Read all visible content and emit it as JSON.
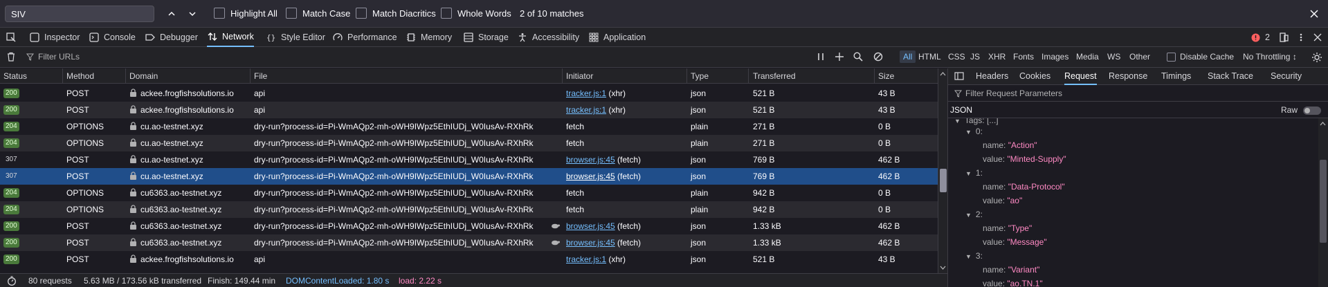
{
  "findbar": {
    "query": "SIV",
    "options": [
      "Highlight All",
      "Match Case",
      "Match Diacritics",
      "Whole Words"
    ],
    "match_count": "2 of 10 matches"
  },
  "tabs": [
    "Inspector",
    "Console",
    "Debugger",
    "Network",
    "Style Editor",
    "Performance",
    "Memory",
    "Storage",
    "Accessibility",
    "Application"
  ],
  "error_count": "2",
  "filter": {
    "placeholder": "Filter URLs",
    "types": [
      "All",
      "HTML",
      "CSS",
      "JS",
      "XHR",
      "Fonts",
      "Images",
      "Media",
      "WS",
      "Other"
    ],
    "disable_cache": "Disable Cache",
    "throttling": "No Throttling ↕"
  },
  "columns": [
    "Status",
    "Method",
    "Domain",
    "File",
    "Initiator",
    "Type",
    "Transferred",
    "Size"
  ],
  "requests": [
    {
      "status": "200",
      "method": "POST",
      "domain": "ackee.frogfishsolutions.io",
      "file": "api",
      "initiator": "tracker.js:1",
      "initiator_suffix": " (xhr)",
      "type": "json",
      "transferred": "521 B",
      "size": "43 B"
    },
    {
      "status": "200",
      "method": "POST",
      "domain": "ackee.frogfishsolutions.io",
      "file": "api",
      "initiator": "tracker.js:1",
      "initiator_suffix": " (xhr)",
      "type": "json",
      "transferred": "521 B",
      "size": "43 B"
    },
    {
      "status": "204",
      "method": "OPTIONS",
      "domain": "cu.ao-testnet.xyz",
      "file": "dry-run?process-id=Pi-WmAQp2-mh-oWH9IWpz5EthIUDj_W0IusAv-RXhRk",
      "initiator": "",
      "initiator_suffix": "fetch",
      "type": "plain",
      "transferred": "271 B",
      "size": "0 B"
    },
    {
      "status": "204",
      "method": "OPTIONS",
      "domain": "cu.ao-testnet.xyz",
      "file": "dry-run?process-id=Pi-WmAQp2-mh-oWH9IWpz5EthIUDj_W0IusAv-RXhRk",
      "initiator": "",
      "initiator_suffix": "fetch",
      "type": "plain",
      "transferred": "271 B",
      "size": "0 B"
    },
    {
      "status": "307",
      "method": "POST",
      "domain": "cu.ao-testnet.xyz",
      "file": "dry-run?process-id=Pi-WmAQp2-mh-oWH9IWpz5EthIUDj_W0IusAv-RXhRk",
      "initiator": "browser.js:45",
      "initiator_suffix": " (fetch)",
      "type": "json",
      "transferred": "769 B",
      "size": "462 B"
    },
    {
      "status": "307",
      "method": "POST",
      "domain": "cu.ao-testnet.xyz",
      "file": "dry-run?process-id=Pi-WmAQp2-mh-oWH9IWpz5EthIUDj_W0IusAv-RXhRk",
      "initiator": "browser.js:45",
      "initiator_suffix": " (fetch)",
      "type": "json",
      "transferred": "769 B",
      "size": "462 B"
    },
    {
      "status": "204",
      "method": "OPTIONS",
      "domain": "cu6363.ao-testnet.xyz",
      "file": "dry-run?process-id=Pi-WmAQp2-mh-oWH9IWpz5EthIUDj_W0IusAv-RXhRk",
      "initiator": "",
      "initiator_suffix": "fetch",
      "type": "plain",
      "transferred": "942 B",
      "size": "0 B"
    },
    {
      "status": "204",
      "method": "OPTIONS",
      "domain": "cu6363.ao-testnet.xyz",
      "file": "dry-run?process-id=Pi-WmAQp2-mh-oWH9IWpz5EthIUDj_W0IusAv-RXhRk",
      "initiator": "",
      "initiator_suffix": "fetch",
      "type": "plain",
      "transferred": "942 B",
      "size": "0 B"
    },
    {
      "status": "200",
      "method": "POST",
      "domain": "cu6363.ao-testnet.xyz",
      "file": "dry-run?process-id=Pi-WmAQp2-mh-oWH9IWpz5EthIUDj_W0IusAv-RXhRk",
      "initiator": "browser.js:45",
      "initiator_suffix": " (fetch)",
      "type": "json",
      "transferred": "1.33 kB",
      "size": "462 B"
    },
    {
      "status": "200",
      "method": "POST",
      "domain": "cu6363.ao-testnet.xyz",
      "file": "dry-run?process-id=Pi-WmAQp2-mh-oWH9IWpz5EthIUDj_W0IusAv-RXhRk",
      "initiator": "browser.js:45",
      "initiator_suffix": " (fetch)",
      "type": "json",
      "transferred": "1.33 kB",
      "size": "462 B"
    },
    {
      "status": "200",
      "method": "POST",
      "domain": "ackee.frogfishsolutions.io",
      "file": "api",
      "initiator": "tracker.js:1",
      "initiator_suffix": " (xhr)",
      "type": "json",
      "transferred": "521 B",
      "size": "43 B"
    }
  ],
  "statusbar": {
    "requests": "80 requests",
    "transferred": "5.63 MB / 173.56 kB transferred",
    "finish": "Finish: 149.44 min",
    "dom": "DOMContentLoaded: 1.80 s",
    "load": "load: 2.22 s"
  },
  "sidebar": {
    "tabs": [
      "Headers",
      "Cookies",
      "Request",
      "Response",
      "Timings",
      "Stack Trace",
      "Security"
    ],
    "filter_placeholder": "Filter Request Parameters",
    "json_label": "JSON",
    "raw_label": "Raw",
    "tags_label": "Tags: [...]",
    "tags": [
      {
        "index": "0:",
        "name": "\"Action\"",
        "value": "\"Minted-Supply\""
      },
      {
        "index": "1:",
        "name": "\"Data-Protocol\"",
        "value": "\"ao\""
      },
      {
        "index": "2:",
        "name": "\"Type\"",
        "value": "\"Message\""
      },
      {
        "index": "3:",
        "name": "\"Variant\"",
        "value": "\"ao.TN.1\""
      }
    ],
    "name_key": "name:",
    "value_key": "value:"
  },
  "colors": {
    "accent": "#75bfff",
    "selected_row": "#204e8a",
    "status_ok": "#4a7a3b",
    "dom_content_loaded": "#75bfff",
    "load": "#ff8ac4",
    "error": "#ff5f5f"
  }
}
